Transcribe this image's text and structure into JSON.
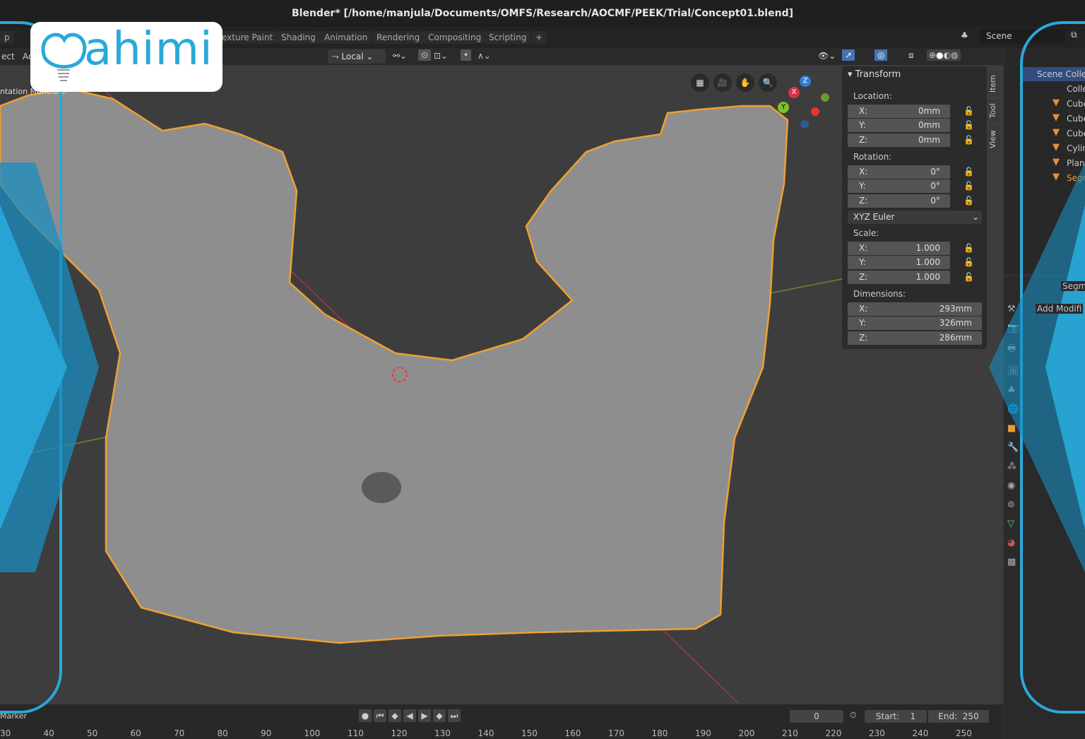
{
  "window": {
    "title": "Blender* [/home/manjula/Documents/OMFS/Research/AOCMF/PEEK/Trial/Concept01.blend]"
  },
  "workspace_tabs": [
    "p",
    "exture Paint",
    "Shading",
    "Animation",
    "Rendering",
    "Compositing",
    "Scripting",
    "+"
  ],
  "scene": {
    "label": "Scene"
  },
  "header_left": [
    "ect",
    "Ac"
  ],
  "viewport_header": {
    "orientation": "Local"
  },
  "viewport": {
    "object_label": "ntation Mandible",
    "gizmo": {
      "x": "X",
      "y": "Y",
      "z": "Z"
    }
  },
  "logo": {
    "text": "Qahimi",
    "color": "#29a9d9"
  },
  "sidebar_tabs": [
    "Item",
    "Tool",
    "View"
  ],
  "transform": {
    "title": "Transform",
    "location_label": "Location:",
    "location": [
      {
        "axis": "X:",
        "value": "0mm"
      },
      {
        "axis": "Y:",
        "value": "0mm"
      },
      {
        "axis": "Z:",
        "value": "0mm"
      }
    ],
    "rotation_label": "Rotation:",
    "rotation": [
      {
        "axis": "X:",
        "value": "0°"
      },
      {
        "axis": "Y:",
        "value": "0°"
      },
      {
        "axis": "Z:",
        "value": "0°"
      }
    ],
    "rotation_mode": "XYZ Euler",
    "scale_label": "Scale:",
    "scale": [
      {
        "axis": "X:",
        "value": "1.000"
      },
      {
        "axis": "Y:",
        "value": "1.000"
      },
      {
        "axis": "Z:",
        "value": "1.000"
      }
    ],
    "dimensions_label": "Dimensions:",
    "dimensions": [
      {
        "axis": "X:",
        "value": "293mm"
      },
      {
        "axis": "Y:",
        "value": "326mm"
      },
      {
        "axis": "Z:",
        "value": "286mm"
      }
    ]
  },
  "outliner": {
    "root": "Scene Collec",
    "items": [
      "Colle",
      "Cube",
      "Cube",
      "Cube",
      "Cylin",
      "Plane",
      "Segm"
    ]
  },
  "properties": {
    "object": "Segme",
    "add_modifier": "Add Modifi"
  },
  "timeline": {
    "marker": "Marker",
    "current_frame": "0",
    "start_label": "Start:",
    "start": "1",
    "end_label": "End:",
    "end": "250",
    "ticks": [
      "30",
      "40",
      "50",
      "60",
      "70",
      "80",
      "90",
      "100",
      "110",
      "120",
      "130",
      "140",
      "150",
      "160",
      "170",
      "180",
      "190",
      "200",
      "210",
      "220",
      "230",
      "240",
      "250"
    ]
  },
  "colors": {
    "accent": "#29a9d9",
    "selection": "#f0a030",
    "ui_bg": "#303030"
  }
}
